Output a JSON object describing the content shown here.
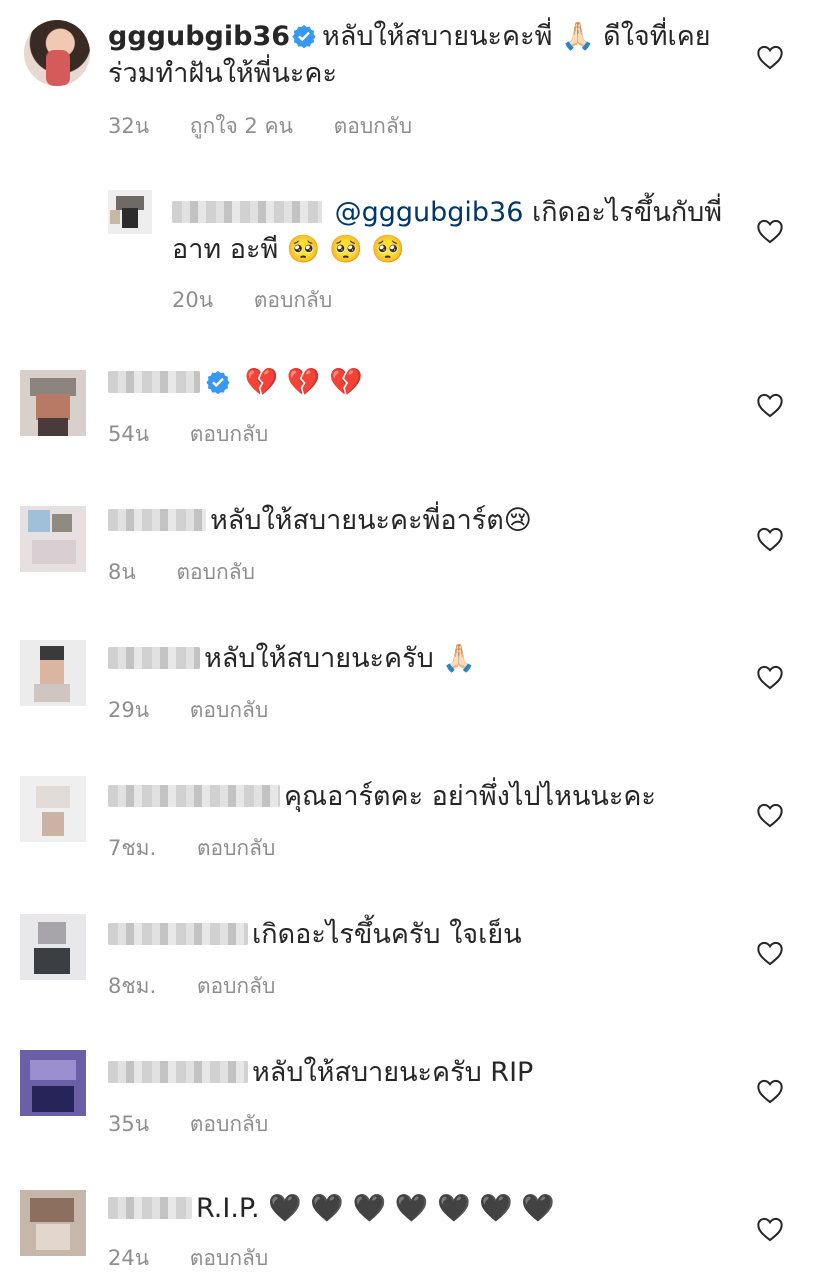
{
  "comments": [
    {
      "username": "gggubgib36",
      "verified": true,
      "text": "หลับให้สบายนะคะพี่ 🙏🏻 ดีใจที่เคยร่วมทำฝันให้พี่นะคะ",
      "time": "32น",
      "likes": "ถูกใจ 2 คน",
      "reply": "ตอบกลับ"
    },
    {
      "mention": "@gggubgib36",
      "text": "เกิดอะไรขึ้นกับพี่อาท อะพี 🥺 🥺 🥺",
      "time": "20น",
      "reply": "ตอบกลับ"
    },
    {
      "text": "💔 💔 💔",
      "time": "54น",
      "reply": "ตอบกลับ"
    },
    {
      "text": "หลับให้สบายนะคะพี่อาร์ต😢",
      "time": "8น",
      "reply": "ตอบกลับ"
    },
    {
      "text": "หลับให้สบายนะครับ 🙏🏻",
      "time": "29น",
      "reply": "ตอบกลับ"
    },
    {
      "text": "คุณอาร์ตคะ อย่าพึ่งไปไหนนะคะ",
      "time": "7ชม.",
      "reply": "ตอบกลับ"
    },
    {
      "text": "เกิดอะไรขึ้นครับ ใจเย็น",
      "time": "8ชม.",
      "reply": "ตอบกลับ"
    },
    {
      "text": "หลับให้สบายนะครับ RIP",
      "time": "35น",
      "reply": "ตอบกลับ"
    },
    {
      "text": "R.I.P. 🖤 🖤 🖤 🖤 🖤 🖤 🖤",
      "time": "24น",
      "reply": "ตอบกลับ"
    }
  ],
  "colors": {
    "text": "#262626",
    "meta": "#8e8e8e",
    "mention": "#00376b",
    "verified": "#3897f0"
  },
  "icons": {
    "like": "heart-outline-icon",
    "verified": "verified-badge-icon"
  }
}
